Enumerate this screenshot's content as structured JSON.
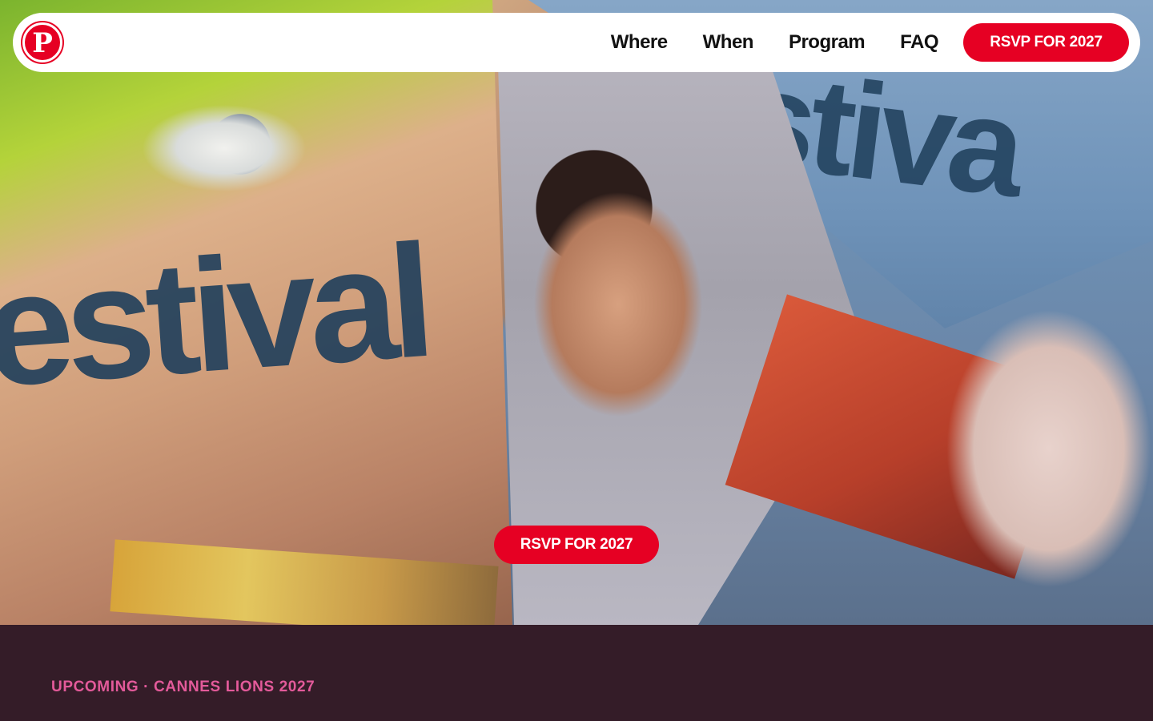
{
  "nav": {
    "logo_icon": "pinterest-logo-icon",
    "logo_glyph": "P",
    "links": [
      "Where",
      "When",
      "Program",
      "FAQ"
    ],
    "cta_label": "RSVP FOR 2027"
  },
  "hero": {
    "cta_label": "RSVP FOR 2027",
    "collage_words": {
      "left": "estival",
      "right": "festiva"
    }
  },
  "section": {
    "eyebrow": "UPCOMING · CANNES LIONS 2027"
  },
  "colors": {
    "brand_red": "#e60023",
    "section_bg": "#341c28",
    "eyebrow_pink": "#e35a9a",
    "nav_text": "#111111"
  }
}
